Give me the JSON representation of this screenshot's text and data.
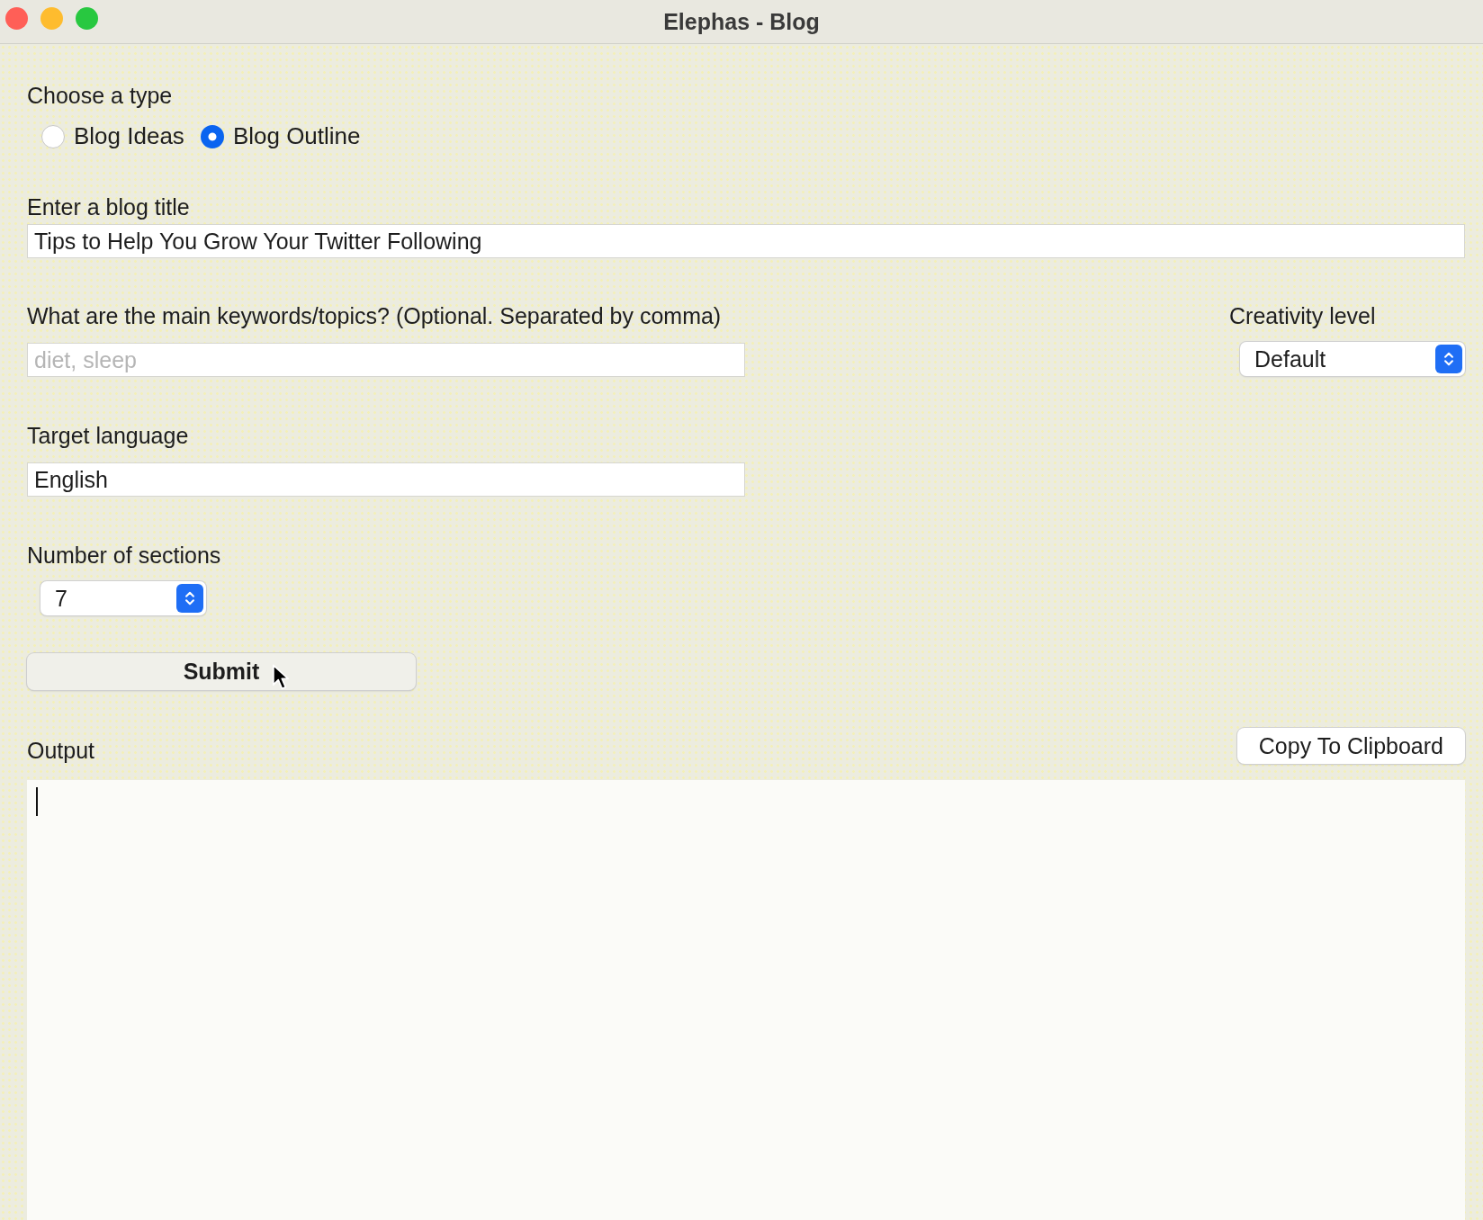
{
  "window": {
    "title": "Elephas - Blog"
  },
  "type_choice": {
    "label": "Choose a type",
    "options": [
      {
        "label": "Blog Ideas",
        "selected": false
      },
      {
        "label": "Blog Outline",
        "selected": true
      }
    ]
  },
  "blog_title": {
    "label": "Enter a blog title",
    "value": "Tips to Help You Grow Your Twitter Following"
  },
  "keywords": {
    "label": "What are the main keywords/topics? (Optional. Separated by comma)",
    "placeholder": "diet, sleep"
  },
  "creativity": {
    "label": "Creativity level",
    "value": "Default"
  },
  "language": {
    "label": "Target language",
    "value": "English"
  },
  "sections": {
    "label": "Number of sections",
    "value": "7"
  },
  "submit_button": "Submit",
  "output": {
    "label": "Output",
    "copy_button": "Copy To Clipboard"
  }
}
